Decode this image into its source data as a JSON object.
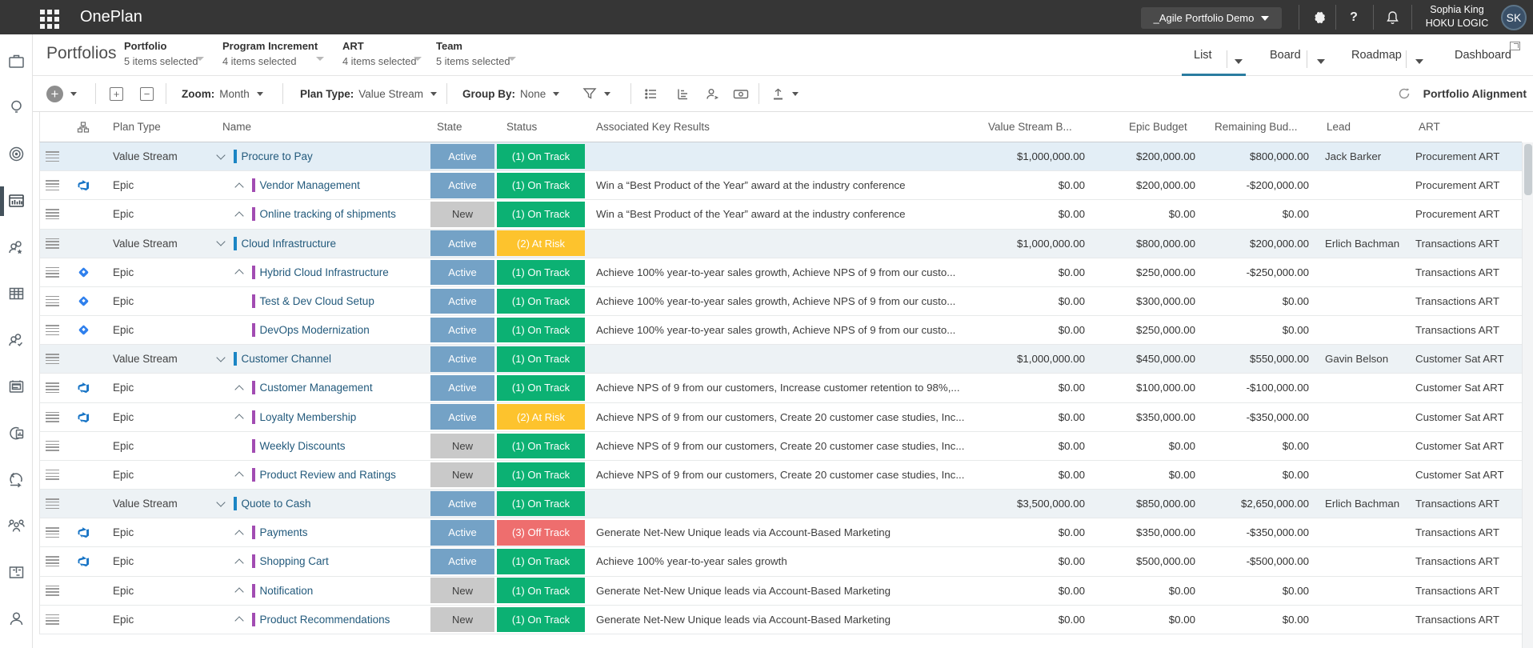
{
  "topbar": {
    "app_title": "OnePlan",
    "demo_button": "_Agile Portfolio Demo",
    "user_name": "Sophia King",
    "user_org": "HOKU LOGIC",
    "avatar_initials": "SK",
    "help_label": "?"
  },
  "appbar": {
    "page_title": "Portfolios",
    "filters": [
      {
        "label": "Portfolio",
        "value": "5 items selected"
      },
      {
        "label": "Program Increment",
        "value": "4 items selected"
      },
      {
        "label": "ART",
        "value": "4 items selected"
      },
      {
        "label": "Team",
        "value": "5 items selected"
      }
    ],
    "views": [
      {
        "label": "List",
        "active": true
      },
      {
        "label": "Board",
        "active": false
      },
      {
        "label": "Roadmap",
        "active": false
      },
      {
        "label": "Dashboard",
        "active": false
      }
    ]
  },
  "toolbar": {
    "zoom_label": "Zoom:",
    "zoom_value": "Month",
    "plan_type_label": "Plan Type:",
    "plan_type_value": "Value Stream",
    "group_by_label": "Group By:",
    "group_by_value": "None",
    "right_button": "Portfolio Alignment"
  },
  "table": {
    "headers": {
      "plan_type": "Plan Type",
      "name": "Name",
      "state": "State",
      "status": "Status",
      "key_results": "Associated Key Results",
      "vs_budget": "Value Stream B...",
      "epic_budget": "Epic Budget",
      "remaining": "Remaining Bud...",
      "lead": "Lead",
      "art": "ART"
    },
    "rows": [
      {
        "type": "vs",
        "hl": true,
        "src": "none",
        "chevron": "down",
        "planType": "Value Stream",
        "name": "Procure to Pay",
        "state": "Active",
        "stateKind": "active",
        "status": "(1) On Track",
        "statusKind": "ontrack",
        "keyResults": "",
        "vsBudget": "$1,000,000.00",
        "epicBudget": "$200,000.00",
        "remaining": "$800,000.00",
        "lead": "Jack Barker",
        "art": "Procurement ART"
      },
      {
        "type": "epic",
        "src": "ado",
        "chevron": "up",
        "planType": "Epic",
        "name": "Vendor Management",
        "state": "Active",
        "stateKind": "active",
        "status": "(1) On Track",
        "statusKind": "ontrack",
        "keyResults": "Win a “Best Product of the Year” award at the industry conference",
        "vsBudget": "$0.00",
        "epicBudget": "$200,000.00",
        "remaining": "-$200,000.00",
        "lead": "",
        "art": "Procurement ART"
      },
      {
        "type": "epic",
        "src": "none",
        "chevron": "up",
        "planType": "Epic",
        "name": "Online tracking of shipments",
        "state": "New",
        "stateKind": "new",
        "status": "(1) On Track",
        "statusKind": "ontrack",
        "keyResults": "Win a “Best Product of the Year” award at the industry conference",
        "vsBudget": "$0.00",
        "epicBudget": "$0.00",
        "remaining": "$0.00",
        "lead": "",
        "art": "Procurement ART"
      },
      {
        "type": "vs",
        "src": "none",
        "chevron": "down",
        "planType": "Value Stream",
        "name": "Cloud Infrastructure",
        "state": "Active",
        "stateKind": "active",
        "status": "(2) At Risk",
        "statusKind": "atrisk",
        "keyResults": "",
        "vsBudget": "$1,000,000.00",
        "epicBudget": "$800,000.00",
        "remaining": "$200,000.00",
        "lead": "Erlich Bachman",
        "art": "Transactions ART"
      },
      {
        "type": "epic",
        "src": "jira",
        "chevron": "up",
        "planType": "Epic",
        "name": "Hybrid Cloud Infrastructure",
        "state": "Active",
        "stateKind": "active",
        "status": "(1) On Track",
        "statusKind": "ontrack",
        "keyResults": "Achieve 100% year-to-year sales growth, Achieve NPS of 9 from our custo...",
        "vsBudget": "$0.00",
        "epicBudget": "$250,000.00",
        "remaining": "-$250,000.00",
        "lead": "",
        "art": "Transactions ART"
      },
      {
        "type": "epic",
        "src": "jira",
        "chevron": "none",
        "planType": "Epic",
        "name": "Test & Dev Cloud Setup",
        "state": "Active",
        "stateKind": "active",
        "status": "(1) On Track",
        "statusKind": "ontrack",
        "keyResults": "Achieve 100% year-to-year sales growth, Achieve NPS of 9 from our custo...",
        "vsBudget": "$0.00",
        "epicBudget": "$300,000.00",
        "remaining": "$0.00",
        "lead": "",
        "art": "Transactions ART"
      },
      {
        "type": "epic",
        "src": "jira",
        "chevron": "none",
        "planType": "Epic",
        "name": "DevOps Modernization",
        "state": "Active",
        "stateKind": "active",
        "status": "(1) On Track",
        "statusKind": "ontrack",
        "keyResults": "Achieve 100% year-to-year sales growth, Achieve NPS of 9 from our custo...",
        "vsBudget": "$0.00",
        "epicBudget": "$250,000.00",
        "remaining": "$0.00",
        "lead": "",
        "art": "Transactions ART"
      },
      {
        "type": "vs",
        "src": "none",
        "chevron": "down",
        "planType": "Value Stream",
        "name": "Customer Channel",
        "state": "Active",
        "stateKind": "active",
        "status": "(1) On Track",
        "statusKind": "ontrack",
        "keyResults": "",
        "vsBudget": "$1,000,000.00",
        "epicBudget": "$450,000.00",
        "remaining": "$550,000.00",
        "lead": "Gavin Belson",
        "art": "Customer Sat ART"
      },
      {
        "type": "epic",
        "src": "ado",
        "chevron": "up",
        "planType": "Epic",
        "name": "Customer Management",
        "state": "Active",
        "stateKind": "active",
        "status": "(1) On Track",
        "statusKind": "ontrack",
        "keyResults": "Achieve NPS of 9 from our customers, Increase customer retention to 98%,...",
        "vsBudget": "$0.00",
        "epicBudget": "$100,000.00",
        "remaining": "-$100,000.00",
        "lead": "",
        "art": "Customer Sat ART"
      },
      {
        "type": "epic",
        "src": "ado",
        "chevron": "up",
        "planType": "Epic",
        "name": "Loyalty Membership",
        "state": "Active",
        "stateKind": "active",
        "status": "(2) At Risk",
        "statusKind": "atrisk",
        "keyResults": "Achieve NPS of 9 from our customers, Create 20 customer case studies, Inc...",
        "vsBudget": "$0.00",
        "epicBudget": "$350,000.00",
        "remaining": "-$350,000.00",
        "lead": "",
        "art": "Customer Sat ART"
      },
      {
        "type": "epic",
        "src": "none",
        "chevron": "none",
        "planType": "Epic",
        "name": "Weekly Discounts",
        "state": "New",
        "stateKind": "new",
        "status": "(1) On Track",
        "statusKind": "ontrack",
        "keyResults": "Achieve NPS of 9 from our customers, Create 20 customer case studies, Inc...",
        "vsBudget": "$0.00",
        "epicBudget": "$0.00",
        "remaining": "$0.00",
        "lead": "",
        "art": "Customer Sat ART"
      },
      {
        "type": "epic",
        "src": "none",
        "chevron": "up",
        "planType": "Epic",
        "name": "Product Review and Ratings",
        "state": "New",
        "stateKind": "new",
        "status": "(1) On Track",
        "statusKind": "ontrack",
        "keyResults": "Achieve NPS of 9 from our customers, Create 20 customer case studies, Inc...",
        "vsBudget": "$0.00",
        "epicBudget": "$0.00",
        "remaining": "$0.00",
        "lead": "",
        "art": "Customer Sat ART"
      },
      {
        "type": "vs",
        "src": "none",
        "chevron": "down",
        "planType": "Value Stream",
        "name": "Quote to Cash",
        "state": "Active",
        "stateKind": "active",
        "status": "(1) On Track",
        "statusKind": "ontrack",
        "keyResults": "",
        "vsBudget": "$3,500,000.00",
        "epicBudget": "$850,000.00",
        "remaining": "$2,650,000.00",
        "lead": "Erlich Bachman",
        "art": "Transactions ART"
      },
      {
        "type": "epic",
        "src": "ado",
        "chevron": "up",
        "planType": "Epic",
        "name": "Payments",
        "state": "Active",
        "stateKind": "active",
        "status": "(3) Off Track",
        "statusKind": "offtrack",
        "keyResults": "Generate Net-New Unique leads via Account-Based Marketing",
        "vsBudget": "$0.00",
        "epicBudget": "$350,000.00",
        "remaining": "-$350,000.00",
        "lead": "",
        "art": "Transactions ART"
      },
      {
        "type": "epic",
        "src": "ado",
        "chevron": "up",
        "planType": "Epic",
        "name": "Shopping Cart",
        "state": "Active",
        "stateKind": "active",
        "status": "(1) On Track",
        "statusKind": "ontrack",
        "keyResults": "Achieve 100% year-to-year sales growth",
        "vsBudget": "$0.00",
        "epicBudget": "$500,000.00",
        "remaining": "-$500,000.00",
        "lead": "",
        "art": "Transactions ART"
      },
      {
        "type": "epic",
        "src": "none",
        "chevron": "up",
        "planType": "Epic",
        "name": "Notification",
        "state": "New",
        "stateKind": "new",
        "status": "(1) On Track",
        "statusKind": "ontrack",
        "keyResults": "Generate Net-New Unique leads via Account-Based Marketing",
        "vsBudget": "$0.00",
        "epicBudget": "$0.00",
        "remaining": "$0.00",
        "lead": "",
        "art": "Transactions ART"
      },
      {
        "type": "epic",
        "src": "none",
        "chevron": "up",
        "planType": "Epic",
        "name": "Product Recommendations",
        "state": "New",
        "stateKind": "new",
        "status": "(1) On Track",
        "statusKind": "ontrack",
        "keyResults": "Generate Net-New Unique leads via Account-Based Marketing",
        "vsBudget": "$0.00",
        "epicBudget": "$0.00",
        "remaining": "$0.00",
        "lead": "",
        "art": "Transactions ART"
      }
    ]
  },
  "colors": {
    "state_active": "#74a2c6",
    "state_new": "#c9c9c9",
    "status_on_track": "#0cb173",
    "status_at_risk": "#fdc32d",
    "status_off_track": "#ee6e6e",
    "vs_name_bar": "#1b85c4",
    "epic_name_bar": "#a24cb2",
    "active_tab_underline": "#2a7ca0",
    "topbar_bg": "#363636"
  }
}
